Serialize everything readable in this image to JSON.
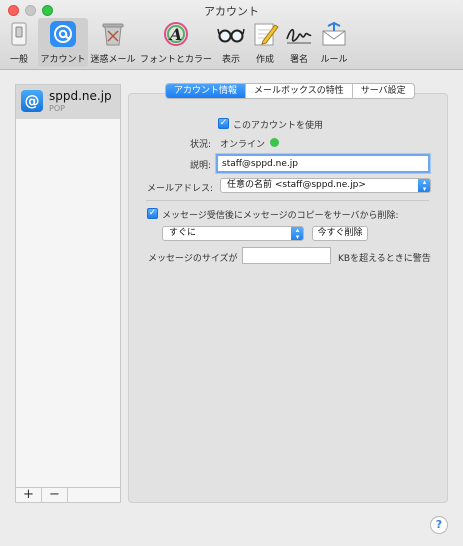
{
  "window": {
    "title": "アカウント"
  },
  "toolbar": {
    "items": [
      {
        "label": "一般",
        "icon": "general-switch-icon"
      },
      {
        "label": "アカウント",
        "icon": "at-sign-icon",
        "selected": true
      },
      {
        "label": "迷惑メール",
        "icon": "junk-mail-icon"
      },
      {
        "label": "フォントとカラー",
        "icon": "font-letter-icon"
      },
      {
        "label": "表示",
        "icon": "glasses-icon"
      },
      {
        "label": "作成",
        "icon": "pencil-note-icon"
      },
      {
        "label": "署名",
        "icon": "signature-icon"
      },
      {
        "label": "ルール",
        "icon": "rules-envelope-icon"
      }
    ]
  },
  "sidebar": {
    "accounts": [
      {
        "name": "sppd.ne.jp",
        "type": "POP"
      }
    ],
    "add_label": "+",
    "remove_label": "−"
  },
  "tabs": [
    {
      "label": "アカウント情報",
      "active": true
    },
    {
      "label": "メールボックスの特性",
      "active": false
    },
    {
      "label": "サーバ設定",
      "active": false
    }
  ],
  "form": {
    "use_account_label": "このアカウントを使用",
    "use_account_checked": true,
    "status_label": "状況:",
    "status_value": "オンライン",
    "status_color": "#3cc54b",
    "description_label": "説明:",
    "description_value": "staff@sppd.ne.jp",
    "email_label": "メールアドレス:",
    "email_value": "任意の名前 <staff@sppd.ne.jp>",
    "delete_copy_label": "メッセージ受信後にメッセージのコピーをサーバから削除:",
    "delete_copy_checked": true,
    "delete_timing_value": "すぐに",
    "delete_now_label": "今すぐ削除",
    "message_size_label": "メッセージのサイズが",
    "message_size_value": "",
    "message_size_suffix": "KBを超えるときに警告"
  },
  "help_label": "?",
  "colors": {
    "accent": "#1a7ef2",
    "close": "#fc605c",
    "zoom": "#34c84a"
  }
}
